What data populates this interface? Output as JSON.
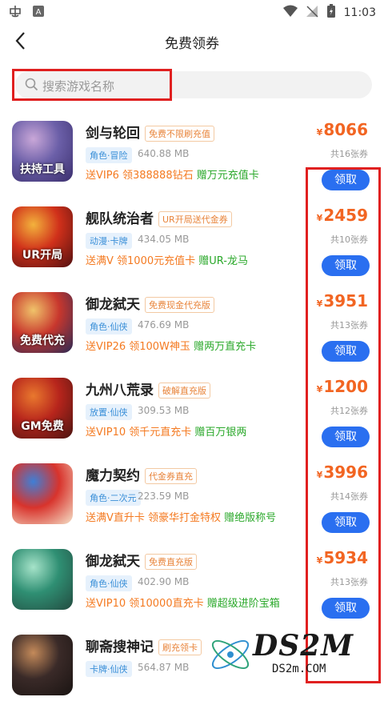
{
  "status": {
    "time": "11:03"
  },
  "header": {
    "title": "免费领券"
  },
  "search": {
    "placeholder": "搜索游戏名称"
  },
  "items": [
    {
      "name": "剑与轮回",
      "badge": "免费不限刷充值",
      "tag": "角色·冒险",
      "size": "640.88 MB",
      "promo1": "送VIP6 领388888钻石",
      "promo2": "",
      "promo3": "赠万元充值卡",
      "currency": "¥",
      "price": "8066",
      "count": "共16张券",
      "button": "领取",
      "thumb_text": "扶持工具",
      "thumb_colors": [
        "#6b5fa8",
        "#c9a7d8",
        "#3b2f6d"
      ]
    },
    {
      "name": "舰队统治者",
      "badge": "UR开局送代金券",
      "tag": "动漫·卡牌",
      "size": "434.05 MB",
      "promo1": "送满V 领1000元充值卡",
      "promo2": "",
      "promo3": "赠UR-龙马",
      "currency": "¥",
      "price": "2459",
      "count": "共10张券",
      "button": "领取",
      "thumb_text": "UR开局",
      "thumb_colors": [
        "#d0301a",
        "#f3b23c",
        "#521010"
      ]
    },
    {
      "name": "御龙弑天",
      "badge": "免费现金代充版",
      "tag": "角色·仙侠",
      "size": "476.69 MB",
      "promo1": "送VIP26 领100W神玉",
      "promo2": "",
      "promo3": "赠两万直充卡",
      "currency": "¥",
      "price": "3951",
      "count": "共13张券",
      "button": "领取",
      "thumb_text": "免费代充",
      "thumb_colors": [
        "#c8372d",
        "#f0c36a",
        "#2a2a55"
      ]
    },
    {
      "name": "九州八荒录",
      "badge": "破解直充版",
      "tag": "放置·仙侠",
      "size": "309.53 MB",
      "promo1": "送VIP10 领千元直充卡",
      "promo2": "",
      "promo3": "赠百万银两",
      "currency": "¥",
      "price": "1200",
      "count": "共12张券",
      "button": "领取",
      "thumb_text": "GM免费",
      "thumb_colors": [
        "#b7251c",
        "#e9782e",
        "#4a1410"
      ]
    },
    {
      "name": "魔力契约",
      "badge": "代金券直充",
      "tag": "角色·二次元",
      "size": "223.59 MB",
      "promo1": "送满V直升卡 领豪华打金特权",
      "promo2": "",
      "promo3": "赠绝版称号",
      "currency": "¥",
      "price": "3996",
      "count": "共14张券",
      "button": "领取",
      "thumb_text": "",
      "thumb_colors": [
        "#d8332c",
        "#3f7fd6",
        "#f5e1c8"
      ]
    },
    {
      "name": "御龙弑天",
      "badge": "免费直充版",
      "tag": "角色·仙侠",
      "size": "402.90 MB",
      "promo1": "送VIP10 领10000直充卡",
      "promo2": "",
      "promo3": "赠超级进阶宝箱",
      "currency": "¥",
      "price": "5934",
      "count": "共13张券",
      "button": "领取",
      "thumb_text": "",
      "thumb_colors": [
        "#2f8f73",
        "#a6e3c9",
        "#234b40"
      ]
    },
    {
      "name": "聊斋搜神记",
      "badge": "刷充领卡",
      "tag": "卡牌·仙侠",
      "size": "564.87 MB",
      "promo1": "",
      "promo2": "",
      "promo3": "",
      "currency": "¥",
      "price": "",
      "count": "",
      "button": "",
      "thumb_text": "",
      "thumb_colors": [
        "#3a2a28",
        "#c48a5a",
        "#1a1412"
      ]
    }
  ],
  "watermark": {
    "title": "DS2M",
    "subtitle": "DS2m.COM"
  }
}
